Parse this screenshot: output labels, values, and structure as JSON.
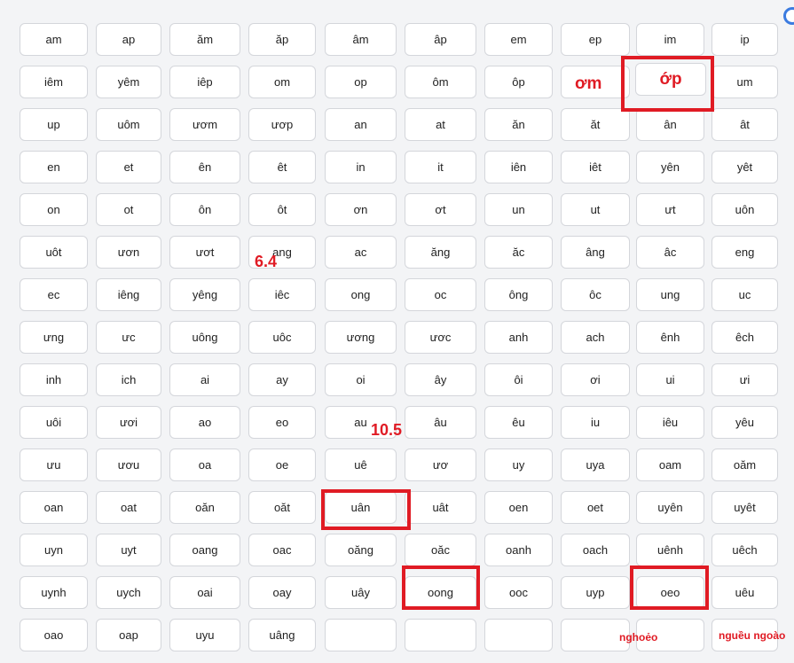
{
  "grid": {
    "cells": [
      "am",
      "ap",
      "ăm",
      "ăp",
      "âm",
      "âp",
      "em",
      "ep",
      "im",
      "ip",
      "iêm",
      "yêm",
      "iêp",
      "om",
      "op",
      "ôm",
      "ôp",
      "",
      "ớp",
      "um",
      "up",
      "uôm",
      "ươm",
      "ươp",
      "an",
      "at",
      "ăn",
      "ăt",
      "ân",
      "ât",
      "en",
      "et",
      "ên",
      "êt",
      "in",
      "it",
      "iên",
      "iêt",
      "yên",
      "yêt",
      "on",
      "ot",
      "ôn",
      "ôt",
      "ơn",
      "ơt",
      "un",
      "ut",
      "ưt",
      "uôn",
      "uôt",
      "ươn",
      "ươt",
      "ang",
      "ac",
      "ăng",
      "ăc",
      "âng",
      "âc",
      "eng",
      "ec",
      "iêng",
      "yêng",
      "iêc",
      "ong",
      "oc",
      "ông",
      "ôc",
      "ung",
      "uc",
      "ưng",
      "ưc",
      "uông",
      "uôc",
      "ương",
      "ươc",
      "anh",
      "ach",
      "ênh",
      "êch",
      "inh",
      "ich",
      "ai",
      "ay",
      "oi",
      "ây",
      "ôi",
      "ơi",
      "ui",
      "ưi",
      "uôi",
      "ươi",
      "ao",
      "eo",
      "au",
      "âu",
      "êu",
      "iu",
      "iêu",
      "yêu",
      "ưu",
      "ươu",
      "oa",
      "oe",
      "uê",
      "ươ",
      "uy",
      "uya",
      "oam",
      "oăm",
      "oan",
      "oat",
      "oăn",
      "oăt",
      "uân",
      "uât",
      "oen",
      "oet",
      "uyên",
      "uyêt",
      "uyn",
      "uyt",
      "oang",
      "oac",
      "oăng",
      "oăc",
      "oanh",
      "oach",
      "uênh",
      "uêch",
      "uynh",
      "uych",
      "oai",
      "oay",
      "uây",
      "oong",
      "ooc",
      "uyp",
      "oeo",
      "uêu",
      "oao",
      "oap",
      "uyu",
      "uâng",
      "",
      "",
      "",
      "",
      "",
      ""
    ]
  },
  "annotations": {
    "om": "ơm",
    "score_a": "6.4",
    "score_b": "10.5",
    "nghoeo": "nghoẻo",
    "ngueu": "nguều ngoào"
  },
  "colors": {
    "accent": "#e01b24",
    "cell_bg": "#ffffff",
    "page_bg": "#f3f4f6"
  }
}
